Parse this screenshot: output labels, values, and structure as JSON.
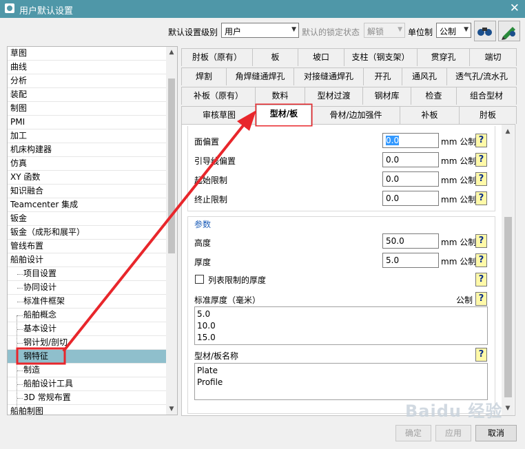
{
  "window": {
    "title": "用户默认设置",
    "close_label": "✕"
  },
  "toolbar": {
    "level_label": "默认设置级别",
    "level_value": "用户",
    "lock_label": "默认的锁定状态",
    "lock_value": "解锁",
    "unit_label": "单位制",
    "unit_value": "公制"
  },
  "tree": {
    "items": [
      {
        "label": "草图"
      },
      {
        "label": "曲线"
      },
      {
        "label": "分析"
      },
      {
        "label": "装配"
      },
      {
        "label": "制图"
      },
      {
        "label": "PMI"
      },
      {
        "label": "加工"
      },
      {
        "label": "机床构建器"
      },
      {
        "label": "仿真"
      },
      {
        "label": "XY 函数"
      },
      {
        "label": "知识融合"
      },
      {
        "label": "Teamcenter 集成"
      },
      {
        "label": "钣金"
      },
      {
        "label": "钣金（成形和展平）"
      },
      {
        "label": "管线布置"
      },
      {
        "label": "船舶设计"
      }
    ],
    "children": [
      {
        "label": "项目设置"
      },
      {
        "label": "协同设计"
      },
      {
        "label": "标准件框架"
      },
      {
        "label": "船舶概念"
      },
      {
        "label": "基本设计"
      },
      {
        "label": "钢计划/剖切"
      },
      {
        "label": "钢特征",
        "selected": true
      },
      {
        "label": "制造"
      },
      {
        "label": "船舶设计工具"
      },
      {
        "label": "3D 常规布置"
      }
    ],
    "last": {
      "label": "船舶制图"
    }
  },
  "tabs": {
    "row1": [
      "肘板（原有）",
      "板",
      "坡口",
      "支柱（钢支架）",
      "贯穿孔",
      "端切"
    ],
    "row2": [
      "焊割",
      "角焊缝通焊孔",
      "对接缝通焊孔",
      "开孔",
      "通风孔",
      "透气孔/流水孔"
    ],
    "row3": [
      "补板（原有）",
      "数料",
      "型材过渡",
      "钢材库",
      "检查",
      "组合型材"
    ],
    "row4": [
      "审核草图",
      "型材/板",
      "骨材/边加强件",
      "补板",
      "肘板"
    ],
    "active": "型材/板"
  },
  "offsets": {
    "rows": [
      {
        "label": "面偏置",
        "value": "0.0",
        "unit": "mm 公制"
      },
      {
        "label": "引导线偏置",
        "value": "0.0",
        "unit": "mm 公制"
      },
      {
        "label": "起始限制",
        "value": "0.0",
        "unit": "mm 公制"
      },
      {
        "label": "终止限制",
        "value": "0.0",
        "unit": "mm 公制"
      }
    ]
  },
  "params": {
    "title": "参数",
    "height_label": "高度",
    "height_value": "50.0",
    "height_unit": "mm 公制",
    "thickness_label": "厚度",
    "thickness_value": "5.0",
    "thickness_unit": "mm 公制",
    "list_thickness_label": "列表限制的厚度",
    "std_thickness_label": "标准厚度（毫米）",
    "std_thickness_unit": "公制",
    "std_thickness_values": [
      "5.0",
      "10.0",
      "15.0"
    ],
    "name_label": "型材/板名称",
    "name_values": [
      "Plate",
      "Profile"
    ]
  },
  "buttons": {
    "ok": "确定",
    "apply": "应用",
    "cancel": "取消"
  },
  "help_glyph": "?",
  "watermark": "Baidu 经验",
  "annotation_color": "#e8262b"
}
